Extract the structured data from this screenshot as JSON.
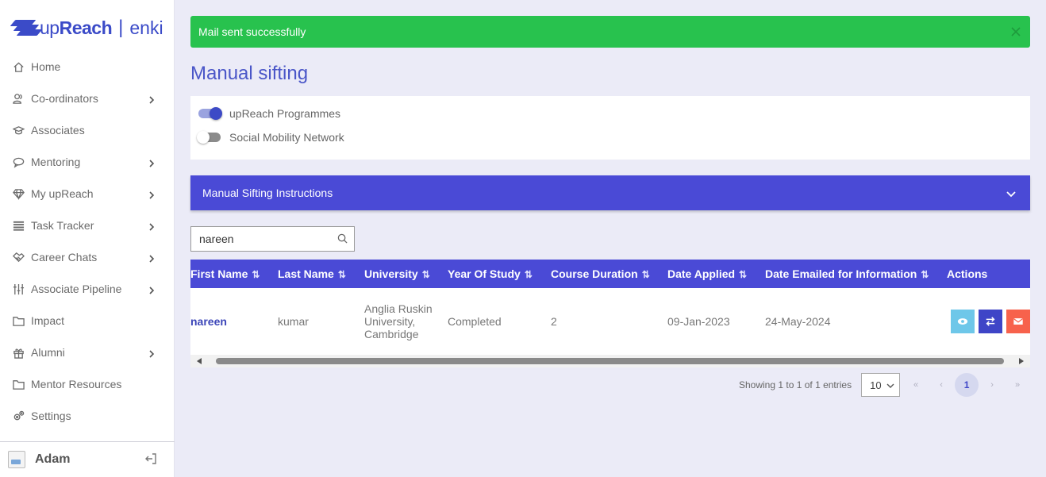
{
  "brand": {
    "name_light": "up",
    "name_bold": "Reach",
    "separator": "|",
    "product": "enki"
  },
  "sidebar": {
    "items": [
      {
        "label": "Home",
        "icon": "home-icon",
        "has_submenu": false
      },
      {
        "label": "Co-ordinators",
        "icon": "users-icon",
        "has_submenu": true
      },
      {
        "label": "Associates",
        "icon": "graduation-cap-icon",
        "has_submenu": false
      },
      {
        "label": "Mentoring",
        "icon": "chat-bubble-icon",
        "has_submenu": true
      },
      {
        "label": "My upReach",
        "icon": "diamond-icon",
        "has_submenu": true
      },
      {
        "label": "Task Tracker",
        "icon": "list-icon",
        "has_submenu": true
      },
      {
        "label": "Career Chats",
        "icon": "handshake-icon",
        "has_submenu": true
      },
      {
        "label": "Associate Pipeline",
        "icon": "sliders-icon",
        "has_submenu": true
      },
      {
        "label": "Impact",
        "icon": "folder-icon",
        "has_submenu": false
      },
      {
        "label": "Alumni",
        "icon": "gift-icon",
        "has_submenu": true
      },
      {
        "label": "Mentor Resources",
        "icon": "folder-icon",
        "has_submenu": false
      },
      {
        "label": "Settings",
        "icon": "gears-icon",
        "has_submenu": false
      }
    ]
  },
  "user": {
    "name": "Adam"
  },
  "alert": {
    "message": "Mail sent successfully",
    "color": "#28c24e"
  },
  "page": {
    "title": "Manual sifting"
  },
  "toggles": [
    {
      "label": "upReach Programmes",
      "on": true
    },
    {
      "label": "Social Mobility Network",
      "on": false
    }
  ],
  "accordion": {
    "title": "Manual Sifting Instructions"
  },
  "search": {
    "value": "nareen",
    "placeholder": ""
  },
  "table": {
    "columns": [
      "First Name",
      "Last Name",
      "University",
      "Year Of Study",
      "Course Duration",
      "Date Applied",
      "Date Emailed for Information",
      "Actions"
    ],
    "rows": [
      {
        "first_name": "nareen",
        "last_name": "kumar",
        "university": "Anglia Ruskin University, Cambridge",
        "year_of_study": "Completed",
        "course_duration": "2",
        "date_applied": "09-Jan-2023",
        "date_emailed": "24-May-2024"
      }
    ]
  },
  "pagination": {
    "info": "Showing 1 to 1 of 1 entries",
    "page_size": "10",
    "first": "«",
    "prev": "‹",
    "current": "1",
    "next": "›",
    "last": "»"
  },
  "colors": {
    "accent": "#4a4ad6",
    "title": "#4a56c8",
    "view": "#6ec7e9",
    "swap": "#3e45c7",
    "mail": "#f7624c"
  }
}
